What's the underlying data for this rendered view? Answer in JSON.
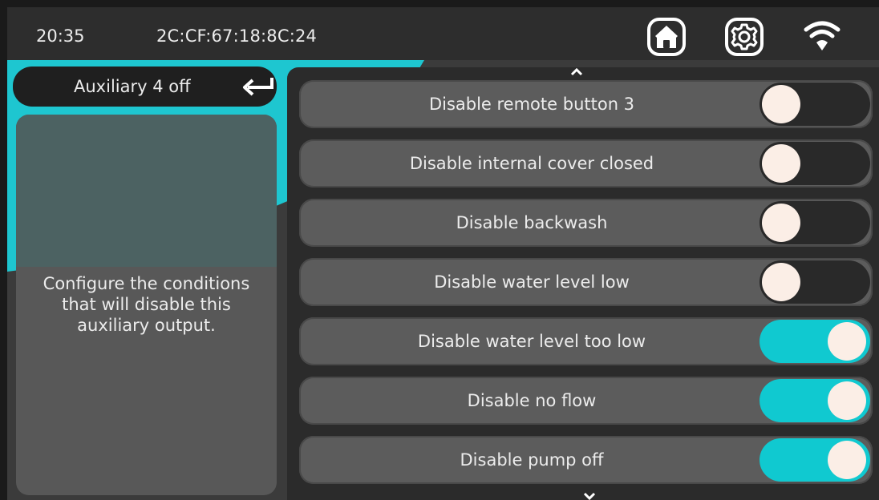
{
  "status_bar": {
    "time": "20:35",
    "mac_address": "2C:CF:67:18:8C:24",
    "icons": [
      "home-icon",
      "gear-icon",
      "wifi-icon"
    ]
  },
  "left_panel": {
    "title": "Auxiliary 4 off",
    "back_icon": "return-arrow-icon",
    "description_lines": [
      "Configure the conditions",
      "that will disable this",
      "auxiliary output."
    ]
  },
  "settings": [
    {
      "label": "Disable remote button 3",
      "enabled": false
    },
    {
      "label": "Disable internal cover closed",
      "enabled": false
    },
    {
      "label": "Disable backwash",
      "enabled": false
    },
    {
      "label": "Disable water level low",
      "enabled": false
    },
    {
      "label": "Disable water level too low",
      "enabled": true
    },
    {
      "label": "Disable no flow",
      "enabled": true
    },
    {
      "label": "Disable pump off",
      "enabled": true
    }
  ],
  "scroll": {
    "up_icon": "chevron-up-icon",
    "down_icon": "chevron-down-icon"
  },
  "colors": {
    "accent": "#10c9d0",
    "background": "#3b3b3b",
    "topbar": "#2d2d2d",
    "row": "#5c5c5c",
    "knob": "#fbeee6"
  }
}
